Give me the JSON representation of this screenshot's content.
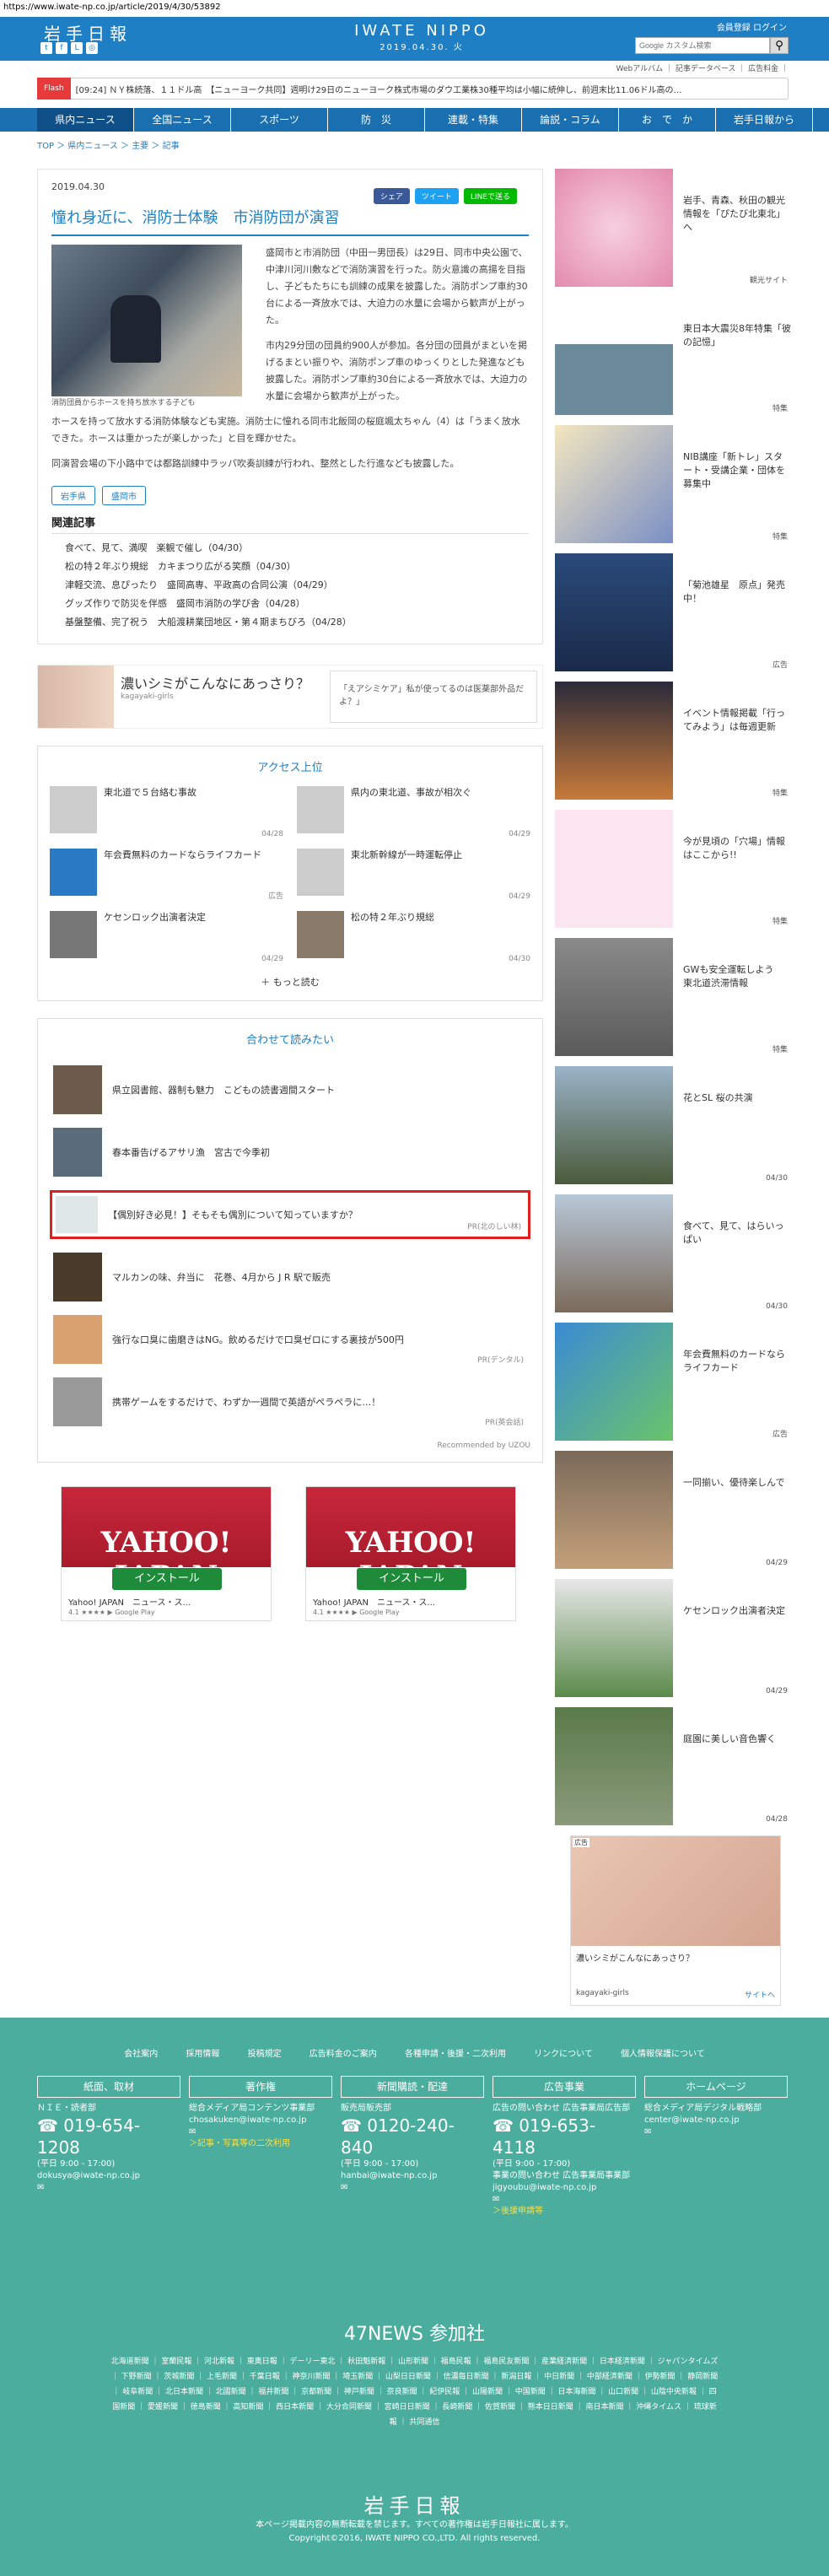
{
  "url": "https://www.iwate-np.co.jp/article/2019/4/30/53892",
  "header": {
    "logo": "岩手日報",
    "brand": "IWATE NIPPO",
    "date": "2019.04.30. 火",
    "user": "会員登録 ログイン",
    "search_placeholder": "Google カスタム検索",
    "sub": "Webアルバム ｜ 記事データベース ｜ 広告料金 ｜"
  },
  "ticker": {
    "badge": "Flash",
    "text": "[09:24] ＮＹ株続落、１１ドル高　【ニューヨーク共同】週明け29日のニューヨーク株式市場のダウ工業株30種平均は小幅に続伸し、前週末比11.06ドル高の…"
  },
  "nav": [
    "県内ニュース",
    "全国ニュース",
    "スポーツ",
    "防　災",
    "連載・特集",
    "論説・コラム",
    "お　で　か　け",
    "岩手日報から"
  ],
  "breadcrumb": "TOP ＞ 県内ニュース ＞ 主要 ＞ 記事",
  "article": {
    "date": "2019.04.30",
    "share": [
      "シェア",
      "ツイート",
      "LINEで送る"
    ],
    "title": "憧れ身近に、消防士体験　市消防団が演習",
    "caption": "消防団員からホースを持ち放水する子ども",
    "paras": [
      "盛岡市と市消防団（中田一男団長）は29日、同市中央公園で、中津川河川敷などで消防演習を行った。防火意識の高揚を目指し、子どもたちにも訓練の成果を披露した。消防ポンプ車約30台による一斉放水では、大迫力の水量に会場から歓声が上がった。",
      "市内29分団の団員約900人が参加。各分団の団員がまといを掲げるまとい振りや、消防ポンプ車のゆっくりとした発進なども披露した。消防ポンプ車約30台による一斉放水では、大迫力の水量に会場から歓声が上がった。",
      "ホースを持って放水する消防体験なども実施。消防士に憧れる同市北飯岡の桜庭颯太ちゃん（4）は「うまく放水できた。ホースは重かったが楽しかった」と目を輝かせた。",
      "同演習会場の下小路中では都路訓練中ラッパ吹奏訓練が行われ、整然とした行進なども披露した。"
    ],
    "tags": [
      "岩手県",
      "盛岡市"
    ]
  },
  "related": {
    "title": "関連記事",
    "items": [
      "食べて、見て、満喫　楽観で催し（04/30）",
      "松の特２年ぶり規総　カキまつり広がる笑顔（04/30）",
      "津軽交流、息ぴったり　盛岡高専、平政高の合同公演（04/29）",
      "グッズ作りで防災を伴感　盛岡市消防の学び舎（04/28）",
      "基盤整備、完了祝う　大船渡耕業団地区・第４期まちびろ（04/28）"
    ]
  },
  "ad1": {
    "title": "濃いシミがこんなにあっさり？",
    "sub": "kagayaki-girls",
    "side": "「えアシミケア」私が使ってるのは医薬部外品だよ？」",
    "label": "広告"
  },
  "access": {
    "title": "アクセス上位",
    "items": [
      {
        "t": "東北道で５台絡む事故",
        "d": "04/28"
      },
      {
        "t": "県内の東北道、事故が相次ぐ",
        "d": "04/29"
      },
      {
        "t": "年会費無料のカードならライフカード",
        "d": "広告"
      },
      {
        "t": "東北新幹線が一時運転停止",
        "d": "04/29"
      },
      {
        "t": "ケセンロック出演者決定",
        "d": "04/29"
      },
      {
        "t": "松の特２年ぶり規総",
        "d": "04/30"
      }
    ],
    "more": "もっと読む"
  },
  "reco": {
    "title": "合わせて読みたい",
    "items": [
      {
        "t": "県立図書館、器制も魅力　こどもの読書週間スタート",
        "pr": ""
      },
      {
        "t": "春本番告げるアサリ漁　宮古で今季初",
        "pr": ""
      },
      {
        "t": "【偶別好き必見！】そもそも偶別について知っていますか？",
        "pr": "PR(北のしい林)"
      },
      {
        "t": "マルカンの味、弁当に　花巻、4月から J R 駅で販売",
        "pr": ""
      },
      {
        "t": "強行な口臭に歯磨きはNG。飲めるだけで口臭ゼロにする裏技が500円",
        "pr": "PR(デンタル)"
      },
      {
        "t": "携帯ゲームをするだけで、わずか一週間で英語がペラペラに…！",
        "pr": "PR(英会話)"
      }
    ],
    "by": "Recommended by UZOU"
  },
  "appads": [
    {
      "logo": "YAHOO! JAPAN",
      "btn": "インストール",
      "name": "Yahoo! JAPAN　ニュース・ス...",
      "rate": "4.1 ★★★★ ▶ Google Play"
    },
    {
      "logo": "YAHOO! JAPAN",
      "btn": "インストール",
      "name": "Yahoo! JAPAN　ニュース・ス...",
      "rate": "4.1 ★★★★ ▶ Google Play"
    }
  ],
  "side": [
    {
      "t": "岩手、青森、秋田の観光情報を「ぴたび北東北」へ",
      "d": "観光サイト"
    },
    {
      "t": "東日本大震災8年特集「彼の記憶」",
      "d": "特集"
    },
    {
      "t": "NIB講座「新トレ」スタート・受講企業・団体を募集中",
      "d": "特集"
    },
    {
      "t": "「菊池雄星　原点」発売中！",
      "d": "広告"
    },
    {
      "t": "イベント情報掲載「行ってみよう」は毎週更新",
      "d": "特集"
    },
    {
      "t": "今が見頃の「穴場」情報はここから!!",
      "d": "特集"
    },
    {
      "t": "GWも安全運転しよう　東北道渋滞情報",
      "d": "特集"
    },
    {
      "t": "花とSL 桜の共演",
      "d": "04/30"
    },
    {
      "t": "食べて、見て、はらいっぱい",
      "d": "04/30"
    },
    {
      "t": "年会費無料のカードならライフカード",
      "d": "広告"
    },
    {
      "t": "一同揃い、優待楽しんで",
      "d": "04/29"
    },
    {
      "t": "ケセンロック出演者決定",
      "d": "04/29"
    },
    {
      "t": "庭園に美しい音色響く",
      "d": "04/28"
    }
  ],
  "sad": {
    "label": "広告",
    "text": "濃いシミがこんなにあっさり？",
    "src": "kagayaki-girls",
    "link": "サイトへ"
  },
  "footer": {
    "links": "会社案内 採用情報 投稿規定 広告料金のご案内 各種申請・後援・二次利用 リンクについて 個人情報保護について",
    "cols": [
      {
        "h": "紙面、取材",
        "s": "ＮＩＥ・読者部",
        "p": "019-654-1208",
        "hr": "(平日 9:00 - 17:00)",
        "m": "dokusya@iwate-np.co.jp",
        "x": ""
      },
      {
        "h": "著作権",
        "s": "総合メディア局コンテンツ事業部",
        "p": "",
        "hr": "",
        "m": "chosakuken@iwate-np.co.jp",
        "x": "＞記事・写真等の二次利用"
      },
      {
        "h": "新聞購読・配達",
        "s": "販売局販売部",
        "p": "0120-240-840",
        "hr": "(平日 9:00 - 17:00)",
        "m": "hanbai@iwate-np.co.jp",
        "x": ""
      },
      {
        "h": "広告事業",
        "s": "広告の問い合わせ 広告事業局広告部",
        "p": "019-653-4118",
        "hr": "(平日 9:00 - 17:00)",
        "m": "事業の問い合わせ 広告事業局事業部 jigyoubu@iwate-np.co.jp",
        "x": "＞後援申請等"
      },
      {
        "h": "ホームページ",
        "s": "総合メディア局デジタル戦略部",
        "p": "",
        "hr": "",
        "m": "center@iwate-np.co.jp",
        "x": ""
      }
    ],
    "n47": "47NEWS 参加社",
    "n47l": "北海道新聞 ｜ 室蘭民報 ｜ 河北新報 ｜ 東奥日報 ｜ デーリー東北 ｜ 秋田魁新報 ｜ 山形新聞 ｜ 福島民報 ｜ 福島民友新聞 ｜ 産業経済新聞 ｜ 日本経済新聞 ｜ ジャパンタイムズ ｜ 下野新聞 ｜ 茨城新聞 ｜ 上毛新聞 ｜ 千葉日報 ｜ 神奈川新聞 ｜ 埼玉新聞 ｜ 山梨日日新聞 ｜ 信濃毎日新聞 ｜ 新潟日報 ｜ 中日新聞 ｜ 中部経済新聞 ｜ 伊勢新聞 ｜ 静岡新聞 ｜ 岐阜新聞 ｜ 北日本新聞 ｜ 北國新聞 ｜ 福井新聞 ｜ 京都新聞 ｜ 神戸新聞 ｜ 奈良新聞 ｜ 紀伊民報 ｜ 山陽新聞 ｜ 中国新聞 ｜ 日本海新聞 ｜ 山口新聞 ｜ 山陰中央新報 ｜ 四国新聞 ｜ 愛媛新聞 ｜ 徳島新聞 ｜ 高知新聞 ｜ 西日本新聞 ｜ 大分合同新聞 ｜ 宮崎日日新聞 ｜ 長崎新聞 ｜ 佐賀新聞 ｜ 熊本日日新聞 ｜ 南日本新聞 ｜ 沖縄タイムス ｜ 琉球新報 ｜ 共同通信",
    "logo": "岩手日報",
    "copy1": "本ページ掲載内容の無断転載を禁じます。すべての著作権は岩手日報社に属します。",
    "copy2": "Copyright©2016, IWATE NIPPO CO.,LTD. All rights reserved."
  }
}
